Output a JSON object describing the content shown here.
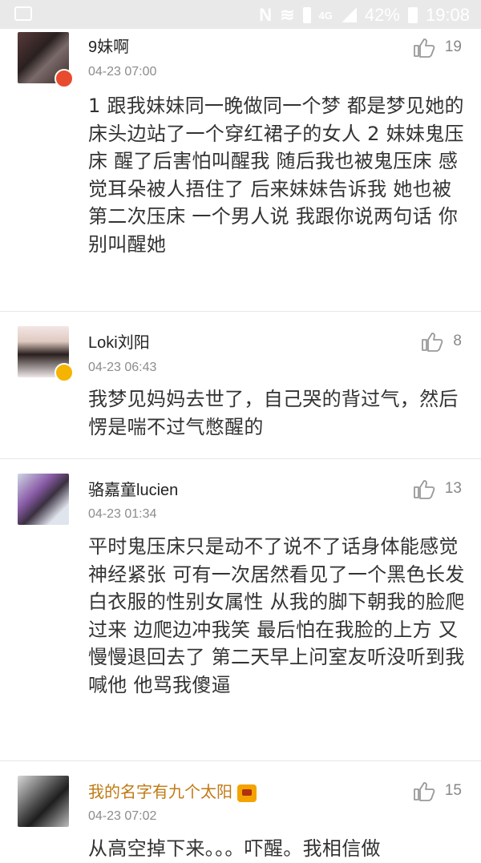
{
  "status_bar": {
    "network": "4G",
    "battery": "42%",
    "time": "19:08"
  },
  "comments": [
    {
      "username": "9妹啊",
      "time": "04-23 07:00",
      "likes": "19",
      "content": "1 跟我妹妹同一晚做同一个梦 都是梦见她的床头边站了一个穿红裙子的女人 2 妹妹鬼压床 醒了后害怕叫醒我 随后我也被鬼压床 感觉耳朵被人捂住了 后来妹妹告诉我 她也被第二次压床 一个男人说 我跟你说两句话 你别叫醒她"
    },
    {
      "username": "Loki刘阳",
      "time": "04-23 06:43",
      "likes": "8",
      "content": "我梦见妈妈去世了，自己哭的背过气，然后愣是喘不过气憋醒的"
    },
    {
      "username": "骆嘉童lucien",
      "time": "04-23 01:34",
      "likes": "13",
      "content": "平时鬼压床只是动不了说不了话身体能感觉 神经紧张 可有一次居然看见了一个黑色长发白衣服的性别女属性 从我的脚下朝我的脸爬过来 边爬边冲我笑 最后怕在我脸的上方 又慢慢退回去了 第二天早上问室友听没听到我喊他 他骂我傻逼"
    },
    {
      "username": "我的名字有九个太阳",
      "time": "04-23 07:02",
      "likes": "15",
      "content": "从高空掉下来。。。吓醒。我相信做"
    }
  ]
}
